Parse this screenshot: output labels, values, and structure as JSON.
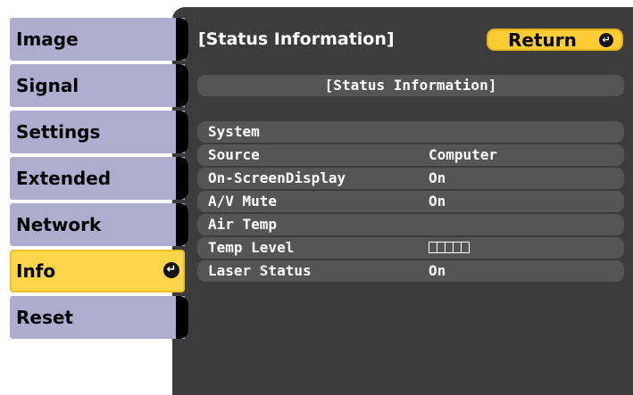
{
  "menu": {
    "items": [
      {
        "label": "Image"
      },
      {
        "label": "Signal"
      },
      {
        "label": "Settings"
      },
      {
        "label": "Extended"
      },
      {
        "label": "Network"
      },
      {
        "label": "Info",
        "active": true
      },
      {
        "label": "Reset"
      }
    ]
  },
  "panel": {
    "title": "[Status Information]",
    "return_label": "Return",
    "header": "[Status Information]"
  },
  "status": {
    "rows": [
      {
        "key": "System",
        "value": ""
      },
      {
        "key": "Source",
        "value": "Computer"
      },
      {
        "key": "On-ScreenDisplay",
        "value": "On"
      },
      {
        "key": "A/V Mute",
        "value": "On"
      },
      {
        "key": "Air Temp",
        "value": ""
      },
      {
        "key": "Temp Level",
        "value": ""
      },
      {
        "key": "Laser Status",
        "value": "On"
      }
    ],
    "temp_level_boxes": 5
  },
  "colors": {
    "menu_bg": "#aeadd0",
    "menu_active": "#ffd54a",
    "panel_bg": "#3c3c3c",
    "row_bg": "#555555",
    "return_bg": "#ffcc33"
  },
  "icons": {
    "enter": "enter-icon"
  }
}
